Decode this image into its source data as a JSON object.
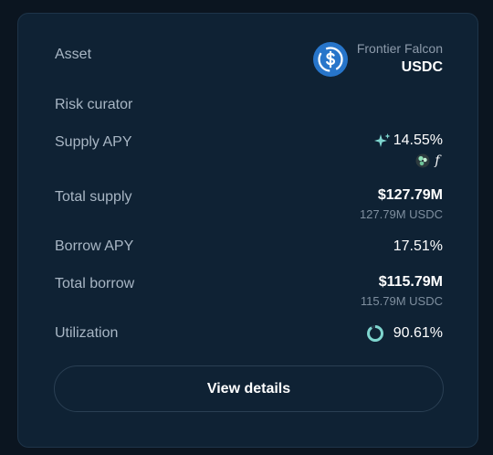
{
  "market": {
    "asset_label": "Asset",
    "vault_name": "Frontier Falcon",
    "asset_symbol": "USDC",
    "asset_icon": "usdc-coin-icon",
    "risk_curator_label": "Risk curator",
    "supply_apy_label": "Supply APY",
    "supply_apy_value": "14.55%",
    "reward_icons": [
      "sparkle-icon",
      "reward-token-icon",
      "f-token-icon"
    ],
    "reward_f_glyph": "f",
    "total_supply_label": "Total supply",
    "total_supply_usd": "$127.79M",
    "total_supply_native": "127.79M USDC",
    "borrow_apy_label": "Borrow APY",
    "borrow_apy_value": "17.51%",
    "total_borrow_label": "Total borrow",
    "total_borrow_usd": "$115.79M",
    "total_borrow_native": "115.79M USDC",
    "utilization_label": "Utilization",
    "utilization_value": "90.61%",
    "utilization_fraction": 0.9061,
    "view_details_label": "View details"
  },
  "colors": {
    "background": "#0b1520",
    "card": "#0f2234",
    "usdc_blue": "#2775ca",
    "accent_teal": "#7fd6cf"
  }
}
